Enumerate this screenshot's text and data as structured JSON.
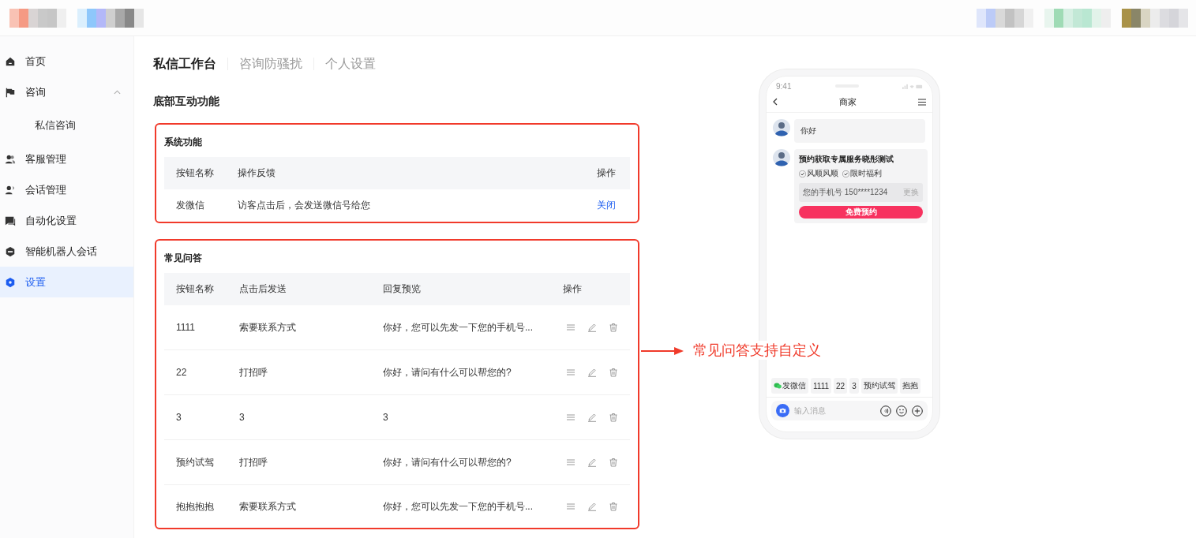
{
  "sidebar": {
    "items": [
      {
        "kind": "home",
        "label": "首页",
        "selected": false
      },
      {
        "kind": "consult",
        "label": "咨询",
        "selected": false,
        "expanded": true,
        "children": [
          {
            "label": "私信咨询",
            "selected": false
          }
        ]
      },
      {
        "kind": "service",
        "label": "客服管理",
        "selected": false
      },
      {
        "kind": "session",
        "label": "会话管理",
        "selected": false
      },
      {
        "kind": "automation",
        "label": "自动化设置",
        "selected": false
      },
      {
        "kind": "robot",
        "label": "智能机器人会话",
        "selected": false
      },
      {
        "kind": "settings",
        "label": "设置",
        "selected": true
      }
    ]
  },
  "tabs": [
    {
      "label": "私信工作台",
      "selected": true
    },
    {
      "label": "咨询防骚扰",
      "selected": false
    },
    {
      "label": "个人设置",
      "selected": false
    }
  ],
  "section_title": "底部互动功能",
  "system_functions": {
    "title": "系统功能",
    "columns": [
      "按钮名称",
      "操作反馈",
      "操作"
    ],
    "rows": [
      {
        "name": "发微信",
        "feedback": "访客点击后，会发送微信号给您",
        "action": "关闭"
      }
    ]
  },
  "faq": {
    "title": "常见问答",
    "columns": [
      "按钮名称",
      "点击后发送",
      "回复预览",
      "操作"
    ],
    "rows": [
      {
        "name": "1111",
        "send": "索要联系方式",
        "preview": "你好，您可以先发一下您的手机号..."
      },
      {
        "name": "22",
        "send": "打招呼",
        "preview": "你好，请问有什么可以帮您的?"
      },
      {
        "name": "3",
        "send": "3",
        "preview": "3"
      },
      {
        "name": "预约试驾",
        "send": "打招呼",
        "preview": "你好，请问有什么可以帮您的?"
      },
      {
        "name": "抱抱抱抱",
        "send": "索要联系方式",
        "preview": "你好，您可以先发一下您的手机号..."
      }
    ]
  },
  "annotation": "常见问答支持自定义",
  "phone": {
    "status_time": "9:41",
    "title": "商家",
    "messages": [
      {
        "kind": "text",
        "text": "你好"
      },
      {
        "kind": "form",
        "title": "预约获取专属服务晓彤测试",
        "tags": [
          "风顺风顺",
          "限时福利"
        ],
        "phone_label": "您的手机号 150****1234",
        "change": "更换",
        "button": "免费预约"
      }
    ],
    "chips": [
      {
        "kind": "wechat",
        "label": "发微信"
      },
      {
        "kind": "text",
        "label": "1111"
      },
      {
        "kind": "text",
        "label": "22"
      },
      {
        "kind": "text",
        "label": "3"
      },
      {
        "kind": "text",
        "label": "预约试驾"
      },
      {
        "kind": "text",
        "label": "抱抱"
      }
    ],
    "input": {
      "placeholder": "输入消息"
    }
  }
}
